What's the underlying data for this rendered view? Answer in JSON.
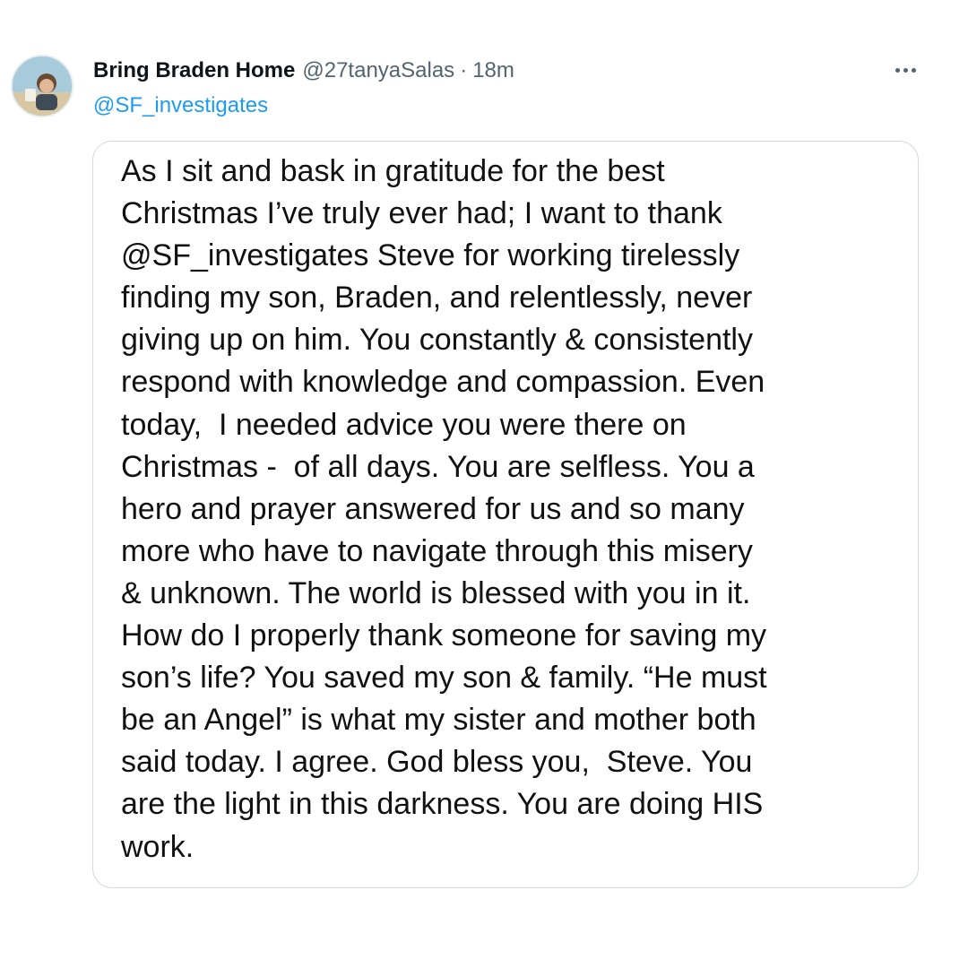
{
  "tweet": {
    "display_name": "Bring Braden Home",
    "handle": "@27tanyaSalas",
    "separator": "·",
    "time": "18m",
    "reply_to": "@SF_investigates",
    "more_icon": "more-horizontal-icon",
    "avatar_icon": "profile-avatar",
    "image_text_lines": [
      "As I sit and bask in gratitude for the best",
      "Christmas I’ve truly ever had; I want to thank",
      "@SF_investigates Steve for working tirelessly",
      "finding my son, Braden, and relentlessly, never",
      "giving up on him. You constantly & consistently",
      "respond with knowledge and compassion. Even",
      "today,  I needed advice you were there on",
      "Christmas -  of all days. You are selfless. You a",
      "hero and prayer answered for us and so many",
      "more who have to navigate through this misery",
      "& unknown. The world is blessed with you in it.",
      "How do I properly thank someone for saving my",
      "son’s life? You saved my son & family. “He must",
      "be an Angel” is what my sister and mother both",
      "said today. I agree. God bless you,  Steve. You",
      "are the light in this darkness. You are doing HIS",
      "work."
    ]
  },
  "colors": {
    "text_primary": "#0f1419",
    "text_secondary": "#536471",
    "link": "#1d9bf0",
    "card_border": "#cfd9de"
  }
}
